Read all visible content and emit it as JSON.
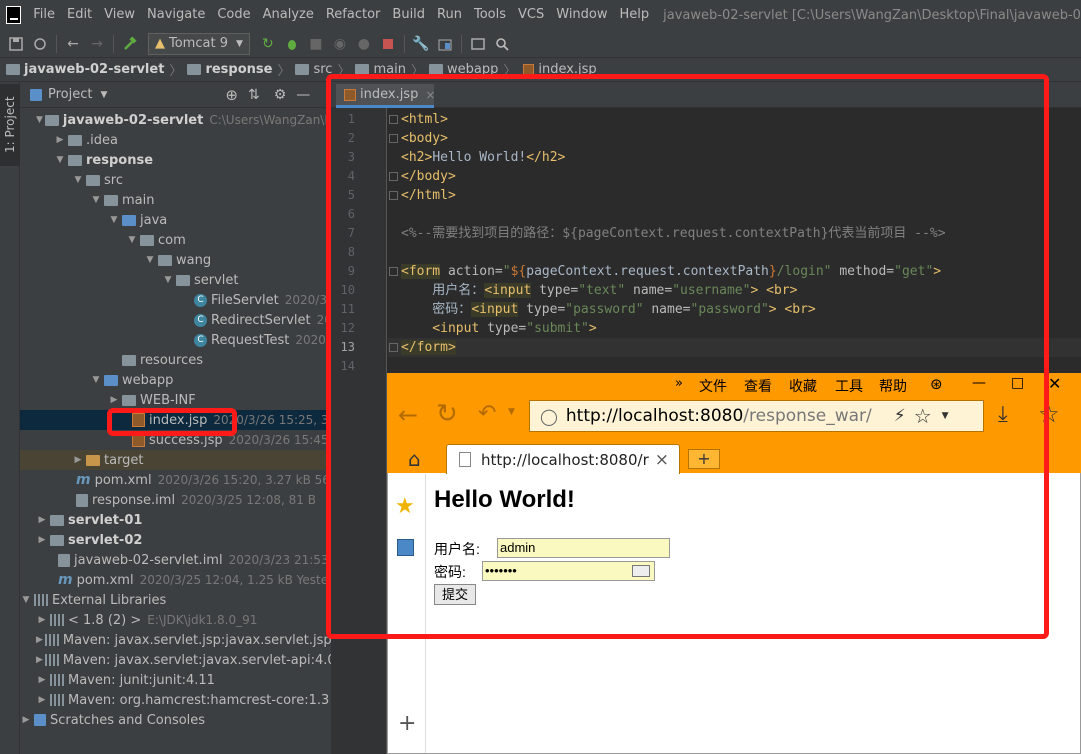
{
  "menubar": {
    "items": [
      "File",
      "Edit",
      "View",
      "Navigate",
      "Code",
      "Analyze",
      "Refactor",
      "Build",
      "Run",
      "Tools",
      "VCS",
      "Window",
      "Help"
    ],
    "title": "javaweb-02-servlet [C:\\Users\\WangZan\\Desktop\\Final\\javaweb-02-servlet] - ..."
  },
  "toolbar": {
    "run_config": "Tomcat 9"
  },
  "breadcrumb": [
    "javaweb-02-servlet",
    "response",
    "src",
    "main",
    "webapp",
    "index.jsp"
  ],
  "sidestrip": {
    "project_tab": "1: Project"
  },
  "project": {
    "header": "Project",
    "rows": [
      {
        "label": "javaweb-02-servlet",
        "meta": "C:\\Users\\WangZan\\Deskt"
      },
      {
        "label": ".idea",
        "meta": ""
      },
      {
        "label": "response",
        "meta": ""
      },
      {
        "label": "src",
        "meta": ""
      },
      {
        "label": "main",
        "meta": ""
      },
      {
        "label": "java",
        "meta": ""
      },
      {
        "label": "com",
        "meta": ""
      },
      {
        "label": "wang",
        "meta": ""
      },
      {
        "label": "servlet",
        "meta": ""
      },
      {
        "label": "FileServlet",
        "meta": "2020/3/25"
      },
      {
        "label": "RedirectServlet",
        "meta": "2020/"
      },
      {
        "label": "RequestTest",
        "meta": "2020/3/2"
      },
      {
        "label": "resources",
        "meta": ""
      },
      {
        "label": "webapp",
        "meta": ""
      },
      {
        "label": "WEB-INF",
        "meta": ""
      },
      {
        "label": "index.jsp",
        "meta": "2020/3/26 15:25, 365 B"
      },
      {
        "label": "success.jsp",
        "meta": "2020/3/26 15:45, 319"
      },
      {
        "label": "target",
        "meta": ""
      },
      {
        "label": "pom.xml",
        "meta": "2020/3/26 15:20, 3.27 kB 56 minu"
      },
      {
        "label": "response.iml",
        "meta": "2020/3/25 12:08, 81 B"
      },
      {
        "label": "servlet-01",
        "meta": ""
      },
      {
        "label": "servlet-02",
        "meta": ""
      },
      {
        "label": "javaweb-02-servlet.iml",
        "meta": "2020/3/23 21:53, 81 B"
      },
      {
        "label": "pom.xml",
        "meta": "2020/3/25 12:04, 1.25 kB Yesterday 0"
      },
      {
        "label": "External Libraries",
        "meta": ""
      },
      {
        "label": "< 1.8 (2) >",
        "meta": "E:\\JDK\\jdk1.8.0_91"
      },
      {
        "label": "Maven: javax.servlet.jsp:javax.servlet.jsp-api:",
        "meta": ""
      },
      {
        "label": "Maven: javax.servlet:javax.servlet-api:4.0.1",
        "meta": ""
      },
      {
        "label": "Maven: junit:junit:4.11",
        "meta": ""
      },
      {
        "label": "Maven: org.hamcrest:hamcrest-core:1.3",
        "meta": ""
      },
      {
        "label": "Scratches and Consoles",
        "meta": ""
      }
    ]
  },
  "editor": {
    "tab": "index.jsp",
    "line_numbers": [
      "1",
      "2",
      "3",
      "4",
      "5",
      "6",
      "7",
      "8",
      "9",
      "10",
      "11",
      "12",
      "13",
      "14"
    ],
    "lines": {
      "l1": "<html>",
      "l2": "<body>",
      "l3a": "<h2>",
      "l3b": "Hello World!",
      "l3c": "</h2>",
      "l4": "</body>",
      "l5": "</html>",
      "l7": "<%--需要找到项目的路径：${pageContext.request.contextPath}代表当前项目 --%>",
      "l9a": "<form",
      "l9b": " action=",
      "l9c": "\"",
      "l9d": "${",
      "l9e": "pageContext.request.contextPath",
      "l9f": "}",
      "l9g": "/login\"",
      "l9h": " method=",
      "l9i": "\"get\"",
      "l9j": ">",
      "l10a": "    用户名：",
      "l10b": "<input",
      "l10c": " type=",
      "l10d": "\"text\"",
      "l10e": " name=",
      "l10f": "\"username\"",
      "l10g": "> <br>",
      "l11a": "    密码：",
      "l11b": "<input",
      "l11c": " type=",
      "l11d": "\"password\"",
      "l11e": " name=",
      "l11f": "\"password\"",
      "l11g": "> <br>",
      "l12a": "    <input",
      "l12b": " type=",
      "l12c": "\"submit\"",
      "l12d": ">",
      "l13": "</form>"
    }
  },
  "browser": {
    "menu": [
      "文件",
      "查看",
      "收藏",
      "工具",
      "帮助"
    ],
    "url_host": "http://localhost:8080",
    "url_path": "/response_war/",
    "tab_title": "http://localhost:8080/r",
    "page": {
      "heading": "Hello World!",
      "username_label": "用户名:",
      "username_value": "admin",
      "password_label": "密码:",
      "password_value": "•••••••",
      "submit_label": "提交"
    }
  }
}
